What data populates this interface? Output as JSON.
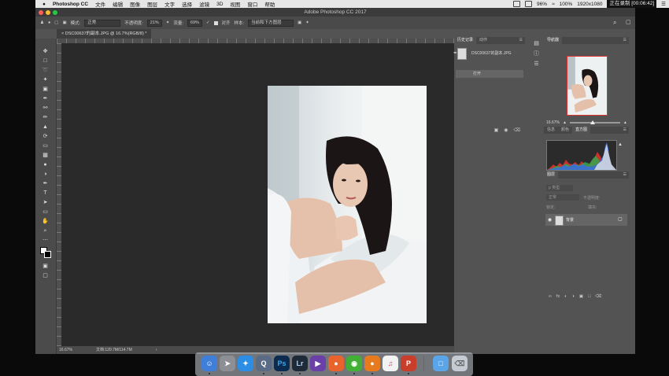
{
  "menubar": {
    "apple": "",
    "app_name": "Photoshop CC",
    "menus": [
      "文件",
      "编辑",
      "图像",
      "图层",
      "文字",
      "选择",
      "滤镜",
      "3D",
      "视图",
      "窗口",
      "帮助"
    ],
    "battery": "100%",
    "resolution": "1920x1080",
    "recording": "正在录制 [00:06:42]",
    "cpu": "96%"
  },
  "window": {
    "title": "Adobe Photoshop CC 2017"
  },
  "options": {
    "mode_label": "模式:",
    "mode_value": "正常",
    "opacity_label": "不透明度:",
    "opacity_value": "21%",
    "flow_label": "流量:",
    "flow_value": "69%",
    "align_label": "对齐",
    "sample_label": "样本:",
    "sample_value": "当前和下方图层"
  },
  "document": {
    "tab": "DSC00637的副本.JPG @ 16.7%(RGB/8) *",
    "zoom": "16.67%",
    "doc_info": "文档:120.7M/114.7M",
    "arrow": "›"
  },
  "history": {
    "tabs": [
      "历史记录",
      "动作"
    ],
    "snapshot_name": "DSC00637的副本.JPG",
    "row_label": "打开"
  },
  "navigator": {
    "title": "导航器",
    "zoom": "16.67%"
  },
  "histogram": {
    "tabs": [
      "信息",
      "颜色",
      "直方图"
    ]
  },
  "layers": {
    "title": "图层",
    "search_placeholder": "ρ 类型",
    "blend_mode": "正常",
    "opacity_label": "不透明度:",
    "lock_label": "锁定:",
    "fill_label": "填充:",
    "layer_name": "背景"
  },
  "colors": {
    "accent_red": "#dd3333",
    "selection": "#656565"
  }
}
